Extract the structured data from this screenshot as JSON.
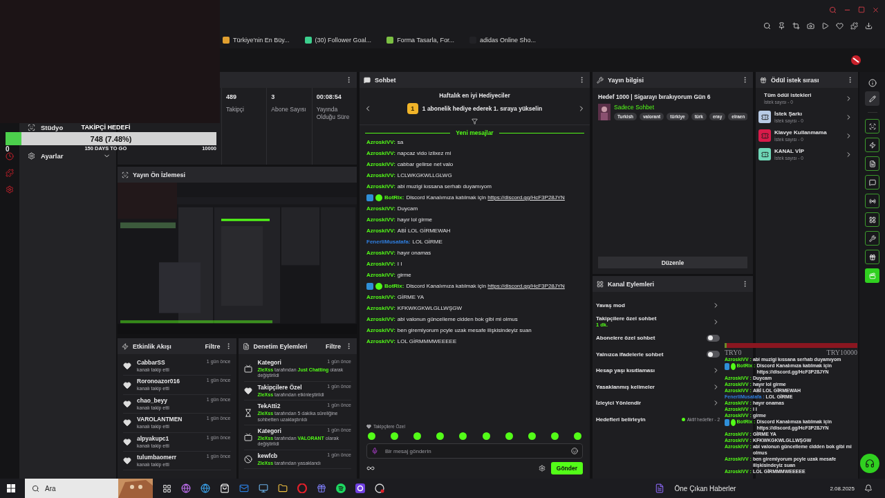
{
  "browser": {
    "bookmarks": [
      {
        "label": "Türkiye'nin En Büy...",
        "color": "#e0a030"
      },
      {
        "label": "(30) Follower Goal...",
        "color": "#3ccf8e"
      },
      {
        "label": "Forma Tasarla, For...",
        "color": "#7bc043"
      },
      {
        "label": "adidas Online Sho...",
        "color": "#222226"
      }
    ]
  },
  "sidebar": {
    "items": [
      {
        "kind": "studio",
        "label": "Stüdyo"
      },
      {
        "kind": "settings",
        "label": "Ayarlar",
        "expanded": false
      }
    ]
  },
  "follower_goal": {
    "title": "TAKİPÇİ HEDEFİ",
    "reading": "748 (7.48%)",
    "level": 0.0748,
    "start": "0",
    "remaining": "150 DAYS TO GO",
    "target": "10000"
  },
  "stats": [
    {
      "value": "489",
      "label": "Takipçi"
    },
    {
      "value": "3",
      "label": "Abone Sayısı"
    },
    {
      "value": "00:08:54",
      "label": "Yayında Olduğu Süre"
    }
  ],
  "preview": {
    "title": "Yayın Ön İzlemesi"
  },
  "activity": {
    "title": "Etkinlik Akışı",
    "filter": "Filtre",
    "items": [
      {
        "user": "CabbarSS",
        "action": "kanalı takip etti",
        "time": "1 gün önce"
      },
      {
        "user": "Roronoazor016",
        "action": "kanalı takip etti",
        "time": "1 gün önce"
      },
      {
        "user": "chao_beyy",
        "action": "kanalı takip etti",
        "time": "1 gün önce"
      },
      {
        "user": "VAROLANTMEN",
        "action": "kanalı takip etti",
        "time": "1 gün önce"
      },
      {
        "user": "alpyakupc1",
        "action": "kanalı takip etti",
        "time": "1 gün önce"
      },
      {
        "user": "tulumbaomerr",
        "action": "kanalı takip etti",
        "time": "1 gün önce"
      }
    ]
  },
  "moderation": {
    "title": "Denetim Eylemleri",
    "filter": "Filtre",
    "items": [
      {
        "kind": "category",
        "title": "Kategori",
        "text": "**ZleXss** tarafından **Just Chatting** olarak değiştirildi",
        "time": "1 gün önce"
      },
      {
        "kind": "followers",
        "title": "Takipçilere Özel",
        "text": "**ZleXss** tarafından etkinleştirildi",
        "time": "1 gün önce"
      },
      {
        "kind": "timeout",
        "title": "TekAtti2",
        "text": "**ZleXss** tarafından 5 dakika süreliğine sohbetten uzaklaştırıldı",
        "time": "1 gün önce"
      },
      {
        "kind": "category",
        "title": "Kategori",
        "text": "**ZleXss** tarafından **VALORANT** olarak değiştirildi",
        "time": "1 gün önce"
      },
      {
        "kind": "ban",
        "title": "kewfcb",
        "text": "**ZleXss** tarafından yasaklandı",
        "time": "1 gün önce"
      }
    ]
  },
  "chat": {
    "title": "Sohbet",
    "gifters_title": "Haftalık en iyi Hediyeciler",
    "rank": "1",
    "gifters_text": "1 abonelik hediye ederek 1. sıraya yükselin",
    "divider": "Yeni mesajlar",
    "messages": [
      {
        "kind": "user",
        "user": "AzroskiVV:",
        "text": "sa",
        "color": "#53fc18"
      },
      {
        "kind": "user",
        "user": "AzroskiVV:",
        "text": "napcaz vido izlixez mi",
        "color": "#53fc18"
      },
      {
        "kind": "user",
        "user": "AzroskiVV:",
        "text": "cabbar gelirse net valo",
        "color": "#53fc18"
      },
      {
        "kind": "user",
        "user": "AzroskiVV:",
        "text": "LCLWKGKWLLGLWG",
        "color": "#53fc18"
      },
      {
        "kind": "user",
        "user": "AzroskiVV:",
        "text": "abi muzigi kıssana serhatı duyamıyom",
        "color": "#53fc18"
      },
      {
        "kind": "bot",
        "user": "BotRix:",
        "text": "Discord Kanalımıza katılmak için",
        "link": "https://discord.gg/HcF3P28JYN",
        "color": "#53fc18"
      },
      {
        "kind": "user",
        "user": "AzroskiVV:",
        "text": "Duycam",
        "color": "#53fc18"
      },
      {
        "kind": "user",
        "user": "AzroskiVV:",
        "text": "hayır lol girme",
        "color": "#53fc18"
      },
      {
        "kind": "user",
        "user": "AzroskiVV:",
        "text": "ABİ LOL GİRMEWAH",
        "color": "#53fc18"
      },
      {
        "kind": "user",
        "user": "FenerliMusatafa:",
        "text": "LOL GİRME",
        "color": "#2f7fe0"
      },
      {
        "kind": "user",
        "user": "AzroskiVV:",
        "text": "hayır onamas",
        "color": "#53fc18"
      },
      {
        "kind": "user",
        "user": "AzroskiVV:",
        "text": "I I",
        "color": "#53fc18"
      },
      {
        "kind": "user",
        "user": "AzroskiVV:",
        "text": "girme",
        "color": "#53fc18"
      },
      {
        "kind": "bot",
        "user": "BotRix:",
        "text": "Discord Kanalımıza katılmak için",
        "link": "https://discord.gg/HcF3P28JYN",
        "color": "#53fc18"
      },
      {
        "kind": "user",
        "user": "AzroskiVV:",
        "text": "GİRME YA",
        "color": "#53fc18"
      },
      {
        "kind": "user",
        "user": "AzroskiVV:",
        "text": "KFKWKGKWLGLLWŞGW",
        "color": "#53fc18"
      },
      {
        "kind": "user",
        "user": "AzroskiVV:",
        "text": "abi valonun güncelleme cidden bok gibi mi olmus",
        "color": "#53fc18"
      },
      {
        "kind": "user",
        "user": "AzroskiVV:",
        "text": "ben giremiyorum pcyle uzak mesafe ilişkisindeyiz suan",
        "color": "#53fc18"
      },
      {
        "kind": "user",
        "user": "AzroskiVV:",
        "text": "LOL GİRMMMWEEEEE",
        "color": "#53fc18"
      }
    ],
    "emote_label": "Takipçilere Özel",
    "placeholder": "Bir mesaj gönderin",
    "send": "Gönder"
  },
  "stream_info": {
    "title": "Yayın bilgisi",
    "stream_title": "Hedef 1000 | Sigarayı bırakıyorum Gün 6",
    "category": "Sadece Sohbet",
    "tags": [
      "Turkish",
      "valorant",
      "türkiye",
      "türk",
      "eray",
      "elraen"
    ],
    "edit": "Düzenle"
  },
  "channel_actions": {
    "title": "Kanal Eylemleri",
    "items": [
      {
        "kind": "link",
        "label": "Yavaş mod"
      },
      {
        "kind": "link",
        "label": "Takipçilere özel sohbet",
        "detail": "1 dk."
      },
      {
        "kind": "toggle",
        "label": "Abonelere özel sohbet",
        "on": false
      },
      {
        "kind": "toggle",
        "label": "Yalnızca ifadelerle sohbet",
        "on": false
      },
      {
        "kind": "link",
        "label": "Hesap yaşı kısıtlaması"
      },
      {
        "kind": "link",
        "label": "Yasaklanmış kelimeler"
      },
      {
        "kind": "link",
        "label": "İzleyici Yönlendir"
      },
      {
        "kind": "goal",
        "label": "Hedefleri belirleyin",
        "detail": "Aktif hedefler - 2"
      }
    ]
  },
  "rewards": {
    "title": "Ödül istek sırası",
    "all": {
      "label": "Tüm ödül istekleri",
      "count": "İstek sayısı - 0"
    },
    "items": [
      {
        "label": "İstek Şarkı",
        "count": "İstek sayısı - 0",
        "color": "#b8cbe6"
      },
      {
        "label": "Klavye Kullanmama",
        "count": "İstek sayısı - 0",
        "color": "#d81b4a"
      },
      {
        "label": "KANAL VİP",
        "count": "İstek sayısı - 0",
        "color": "#6fd8b8"
      }
    ]
  },
  "overlay": {
    "donation_start": "TRY0",
    "donation_end": "TRY10000",
    "messages": [
      {
        "kind": "user",
        "user": "AzroskiVV :",
        "text": "abi muzigi kıssana serhatı duyamıyom",
        "color": "#53fc18"
      },
      {
        "kind": "bot",
        "user": "BotRix :",
        "text": "Discord Kanalımıza katılmak için https://discord.gg/HcF3P28JYN",
        "color": "#53fc18"
      },
      {
        "kind": "user",
        "user": "AzroskiVV :",
        "text": "Duycam",
        "color": "#53fc18"
      },
      {
        "kind": "user",
        "user": "AzroskiVV :",
        "text": "hayır lol girme",
        "color": "#53fc18"
      },
      {
        "kind": "user",
        "user": "AzroskiVV :",
        "text": "ABİ LOL GİRMEWAH",
        "color": "#53fc18"
      },
      {
        "kind": "user",
        "user": "FenerliMusatafa :",
        "text": "LOL GİRME",
        "color": "#2f7fe0"
      },
      {
        "kind": "user",
        "user": "AzroskiVV :",
        "text": "hayır onamas",
        "color": "#53fc18"
      },
      {
        "kind": "user",
        "user": "AzroskiVV :",
        "text": "I I",
        "color": "#53fc18"
      },
      {
        "kind": "user",
        "user": "AzroskiVV :",
        "text": "girme",
        "color": "#53fc18"
      },
      {
        "kind": "bot",
        "user": "BotRix :",
        "text": "Discord Kanalımıza katılmak için https://discord.gg/HcF3P28JYN",
        "color": "#53fc18"
      },
      {
        "kind": "user",
        "user": "AzroskiVV :",
        "text": "GİRME YA",
        "color": "#53fc18"
      },
      {
        "kind": "user",
        "user": "AzroskiVV :",
        "text": "KFKWKGKWLGLLWŞGW",
        "color": "#53fc18"
      },
      {
        "kind": "user",
        "user": "AzroskiVV :",
        "text": "abi valonun güncelleme cidden bok gibi mi olmus",
        "color": "#53fc18"
      },
      {
        "kind": "user",
        "user": "AzroskiVV :",
        "text": "ben giremiyorum pcyle uzak mesafe ilişkisindeyiz suan",
        "color": "#53fc18"
      },
      {
        "kind": "user",
        "user": "AzroskiVV :",
        "text": "LOL GİRMMMWEEEEE",
        "color": "#53fc18"
      }
    ]
  },
  "taskbar": {
    "search": "Ara",
    "news": "Öne Çıkan Haberler",
    "date": "2.08.2025"
  }
}
